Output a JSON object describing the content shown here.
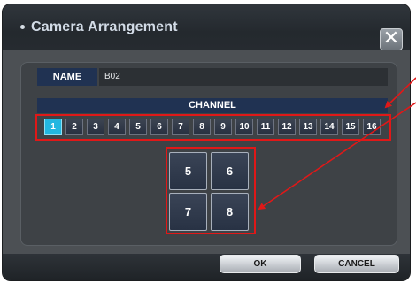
{
  "dialog": {
    "title": "Camera Arrangement",
    "close_symbol": "✕"
  },
  "name": {
    "label": "NAME",
    "value": "B02"
  },
  "channel": {
    "header": "CHANNEL",
    "buttons": [
      "1",
      "2",
      "3",
      "4",
      "5",
      "6",
      "7",
      "8",
      "9",
      "10",
      "11",
      "12",
      "13",
      "14",
      "15",
      "16"
    ],
    "active": "1"
  },
  "layout_grid": {
    "tiles": [
      "5",
      "6",
      "7",
      "8"
    ]
  },
  "actions": {
    "ok_label": "OK",
    "cancel_label": "CANCEL"
  },
  "colors": {
    "highlight": "#e01818",
    "active_channel": "#23b7e0",
    "label_background": "#203252"
  }
}
